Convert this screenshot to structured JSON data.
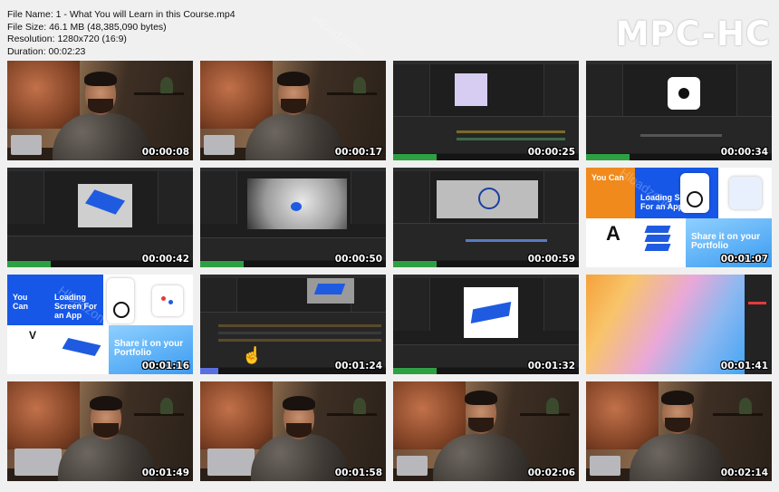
{
  "file_info": {
    "name_line": "File Name: 1 - What You will Learn in this Course.mp4",
    "size_line": "File Size: 46.1 MB (48,385,090 bytes)",
    "resolution_line": "Resolution: 1280x720 (16:9)",
    "duration_line": "Duration: 00:02:23"
  },
  "logo": "MPC-HC",
  "watermark": "Hloadzone",
  "thumbnails": [
    {
      "time": "00:00:08",
      "scene": "presenter"
    },
    {
      "time": "00:00:17",
      "scene": "presenter"
    },
    {
      "time": "00:00:25",
      "scene": "editor"
    },
    {
      "time": "00:00:34",
      "scene": "editor"
    },
    {
      "time": "00:00:42",
      "scene": "editor"
    },
    {
      "time": "00:00:50",
      "scene": "editor"
    },
    {
      "time": "00:00:59",
      "scene": "editor"
    },
    {
      "time": "00:01:07",
      "scene": "slide"
    },
    {
      "time": "00:01:16",
      "scene": "slide"
    },
    {
      "time": "00:01:24",
      "scene": "editor"
    },
    {
      "time": "00:01:32",
      "scene": "editor"
    },
    {
      "time": "00:01:41",
      "scene": "gradient"
    },
    {
      "time": "00:01:49",
      "scene": "presenter"
    },
    {
      "time": "00:01:58",
      "scene": "presenter"
    },
    {
      "time": "00:02:06",
      "scene": "presenter"
    },
    {
      "time": "00:02:14",
      "scene": "presenter"
    }
  ],
  "slide_text": {
    "you_can": "You Can",
    "loading": "Loading Screen For an App",
    "share": "Share it on your Portfolio",
    "letter_a": "A",
    "letter_v": "V"
  }
}
